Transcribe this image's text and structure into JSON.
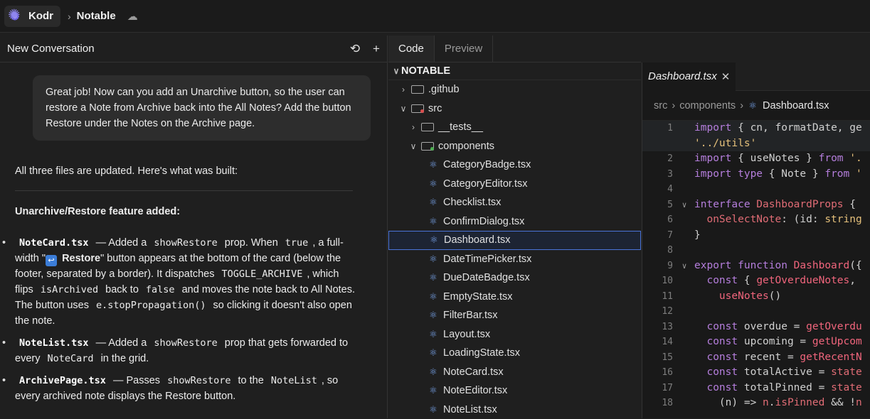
{
  "header": {
    "app_name": "Kodr",
    "separator": "›",
    "project_name": "Notable"
  },
  "conversation": {
    "title": "New Conversation",
    "user_message": "Great job! Now can you add an Unarchive button, so the user can restore a Note from Archive back into the All Notes? Add the button Restore under the Notes on the Archive page.",
    "intro": "All three files are updated. Here's what was built:",
    "heading": "Unarchive/Restore feature added:",
    "b1": {
      "file": "NoteCard.tsx",
      "t1": "— Added a",
      "c1": "showRestore",
      "t2": "prop. When",
      "c2": "true",
      "t3": ", a full-width \"",
      "restore": "Restore",
      "t4": "\" button appears at the bottom of the card (below the footer, separated by a border). It dispatches",
      "c3": "TOGGLE_ARCHIVE",
      "t5": ", which flips",
      "c4": "isArchived",
      "t6": "back to",
      "c5": "false",
      "t7": "and moves the note back to All Notes. The button uses",
      "c6": "e.stopPropagation()",
      "t8": "so clicking it doesn't also open the note."
    },
    "b2": {
      "file": "NoteList.tsx",
      "t1": "— Added a",
      "c1": "showRestore",
      "t2": "prop that gets forwarded to every",
      "c2": "NoteCard",
      "t3": "in the grid."
    },
    "b3": {
      "file": "ArchivePage.tsx",
      "t1": "— Passes",
      "c1": "showRestore",
      "t2": "to the",
      "c2": "NoteList",
      "t3": ", so every archived note displays the Restore button."
    }
  },
  "tabs": {
    "code": "Code",
    "preview": "Preview"
  },
  "tree": {
    "root": "NOTABLE",
    "github": ".github",
    "src": "src",
    "tests": "__tests__",
    "components": "components",
    "files": [
      "CategoryBadge.tsx",
      "CategoryEditor.tsx",
      "Checklist.tsx",
      "ConfirmDialog.tsx",
      "Dashboard.tsx",
      "DateTimePicker.tsx",
      "DueDateBadge.tsx",
      "EmptyState.tsx",
      "FilterBar.tsx",
      "Layout.tsx",
      "LoadingState.tsx",
      "NoteCard.tsx",
      "NoteEditor.tsx",
      "NoteList.tsx"
    ],
    "selected": "Dashboard.tsx"
  },
  "editor": {
    "tab": "Dashboard.tsx",
    "breadcrumb": [
      "src",
      "components",
      "Dashboard.tsx"
    ]
  },
  "colors": {
    "accent": "#4a74d9",
    "keyword": "#b57edc",
    "type": "#e06c75",
    "function": "#f0657c",
    "string": "#e5c07b"
  }
}
